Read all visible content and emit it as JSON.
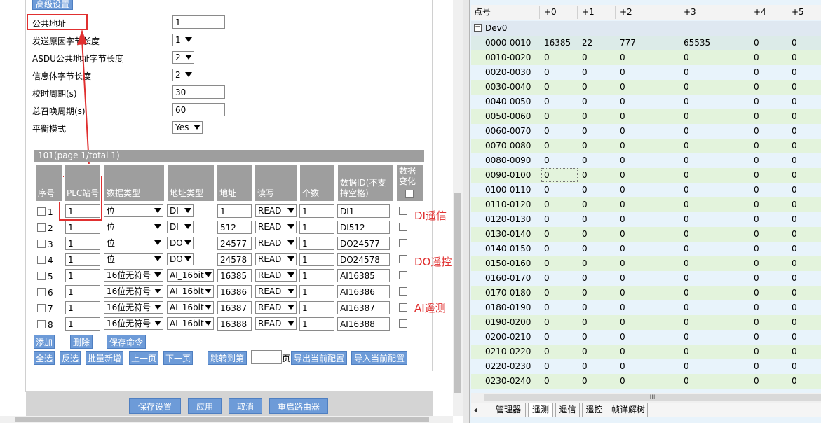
{
  "left": {
    "advanced_tab": "高级设置",
    "form": [
      {
        "label": "公共地址",
        "type": "input",
        "value": "1"
      },
      {
        "label": "发送原因字节长度",
        "type": "select",
        "value": "1"
      },
      {
        "label": "ASDU公共地址字节长度",
        "type": "select",
        "value": "2"
      },
      {
        "label": "信息体字节长度",
        "type": "select",
        "value": "2"
      },
      {
        "label": "校时周期(s)",
        "type": "input",
        "value": "30"
      },
      {
        "label": "总召唤周期(s)",
        "type": "input",
        "value": "60"
      },
      {
        "label": "平衡模式",
        "type": "select",
        "value": "Yes"
      }
    ],
    "table_caption": "101(page 1/total 1)",
    "headers": [
      "序号",
      "PLC站号",
      "数据类型",
      "地址类型",
      "地址",
      "读写",
      "个数",
      "数据ID(不支持空格)",
      "数据变化"
    ],
    "rows": [
      {
        "no": "1",
        "plc": "1",
        "dtype": "位",
        "atype": "DI",
        "addr": "1",
        "rw": "READ",
        "count": "1",
        "id": "DI1"
      },
      {
        "no": "2",
        "plc": "1",
        "dtype": "位",
        "atype": "DI",
        "addr": "512",
        "rw": "READ",
        "count": "1",
        "id": "DI512"
      },
      {
        "no": "3",
        "plc": "1",
        "dtype": "位",
        "atype": "DO",
        "addr": "24577",
        "rw": "READ",
        "count": "1",
        "id": "DO24577"
      },
      {
        "no": "4",
        "plc": "1",
        "dtype": "位",
        "atype": "DO",
        "addr": "24578",
        "rw": "READ",
        "count": "1",
        "id": "DO24578"
      },
      {
        "no": "5",
        "plc": "1",
        "dtype": "16位无符号",
        "atype": "AI_16bit",
        "addr": "16385",
        "rw": "READ",
        "count": "1",
        "id": "AI16385"
      },
      {
        "no": "6",
        "plc": "1",
        "dtype": "16位无符号",
        "atype": "AI_16bit",
        "addr": "16386",
        "rw": "READ",
        "count": "1",
        "id": "AI16386"
      },
      {
        "no": "7",
        "plc": "1",
        "dtype": "16位无符号",
        "atype": "AI_16bit",
        "addr": "16387",
        "rw": "READ",
        "count": "1",
        "id": "AI16387"
      },
      {
        "no": "8",
        "plc": "1",
        "dtype": "16位无符号",
        "atype": "AI_16bit",
        "addr": "16388",
        "rw": "READ",
        "count": "1",
        "id": "AI16388"
      }
    ],
    "annotations": [
      "DI遥信",
      "DO遥控",
      "AI遥测"
    ],
    "buttons_row1": [
      "添加",
      "删除",
      "保存命令"
    ],
    "buttons_row2": [
      "全选",
      "反选",
      "批量新增",
      "上一页",
      "下一页",
      "跳转到第"
    ],
    "page_unit": "页",
    "buttons_row2b": [
      "导出当前配置",
      "导入当前配置"
    ],
    "bottom_buttons": [
      "保存设置",
      "应用",
      "取消",
      "重启路由器"
    ]
  },
  "right": {
    "columns": [
      "点号",
      "+0",
      "+1",
      "+2",
      "+3",
      "+4",
      "+5"
    ],
    "group": "Dev0",
    "rows": [
      {
        "range": "0000-0010",
        "v": [
          "16385",
          "22",
          "777",
          "65535",
          "0",
          "0"
        ]
      },
      {
        "range": "0010-0020",
        "v": [
          "0",
          "0",
          "0",
          "0",
          "0",
          "0"
        ]
      },
      {
        "range": "0020-0030",
        "v": [
          "0",
          "0",
          "0",
          "0",
          "0",
          "0"
        ]
      },
      {
        "range": "0030-0040",
        "v": [
          "0",
          "0",
          "0",
          "0",
          "0",
          "0"
        ]
      },
      {
        "range": "0040-0050",
        "v": [
          "0",
          "0",
          "0",
          "0",
          "0",
          "0"
        ]
      },
      {
        "range": "0050-0060",
        "v": [
          "0",
          "0",
          "0",
          "0",
          "0",
          "0"
        ]
      },
      {
        "range": "0060-0070",
        "v": [
          "0",
          "0",
          "0",
          "0",
          "0",
          "0"
        ]
      },
      {
        "range": "0070-0080",
        "v": [
          "0",
          "0",
          "0",
          "0",
          "0",
          "0"
        ]
      },
      {
        "range": "0080-0090",
        "v": [
          "0",
          "0",
          "0",
          "0",
          "0",
          "0"
        ]
      },
      {
        "range": "0090-0100",
        "v": [
          "0",
          "0",
          "0",
          "0",
          "0",
          "0"
        ]
      },
      {
        "range": "0100-0110",
        "v": [
          "0",
          "0",
          "0",
          "0",
          "0",
          "0"
        ]
      },
      {
        "range": "0110-0120",
        "v": [
          "0",
          "0",
          "0",
          "0",
          "0",
          "0"
        ]
      },
      {
        "range": "0120-0130",
        "v": [
          "0",
          "0",
          "0",
          "0",
          "0",
          "0"
        ]
      },
      {
        "range": "0130-0140",
        "v": [
          "0",
          "0",
          "0",
          "0",
          "0",
          "0"
        ]
      },
      {
        "range": "0140-0150",
        "v": [
          "0",
          "0",
          "0",
          "0",
          "0",
          "0"
        ]
      },
      {
        "range": "0150-0160",
        "v": [
          "0",
          "0",
          "0",
          "0",
          "0",
          "0"
        ]
      },
      {
        "range": "0160-0170",
        "v": [
          "0",
          "0",
          "0",
          "0",
          "0",
          "0"
        ]
      },
      {
        "range": "0170-0180",
        "v": [
          "0",
          "0",
          "0",
          "0",
          "0",
          "0"
        ]
      },
      {
        "range": "0180-0190",
        "v": [
          "0",
          "0",
          "0",
          "0",
          "0",
          "0"
        ]
      },
      {
        "range": "0190-0200",
        "v": [
          "0",
          "0",
          "0",
          "0",
          "0",
          "0"
        ]
      },
      {
        "range": "0200-0210",
        "v": [
          "0",
          "0",
          "0",
          "0",
          "0",
          "0"
        ]
      },
      {
        "range": "0210-0220",
        "v": [
          "0",
          "0",
          "0",
          "0",
          "0",
          "0"
        ]
      },
      {
        "range": "0220-0230",
        "v": [
          "0",
          "0",
          "0",
          "0",
          "0",
          "0"
        ]
      },
      {
        "range": "0230-0240",
        "v": [
          "0",
          "0",
          "0",
          "0",
          "0",
          "0"
        ]
      }
    ],
    "scroll_mark": "III",
    "tabs": [
      "管理器",
      "遥测",
      "遥信",
      "遥控",
      "帧详解树"
    ],
    "active_tab": 1
  },
  "colors": {
    "accent": "#6d9bd8",
    "header_gray": "#9e9e9e",
    "annotation_red": "#e03030",
    "grid_green": "#e3f3dc"
  }
}
